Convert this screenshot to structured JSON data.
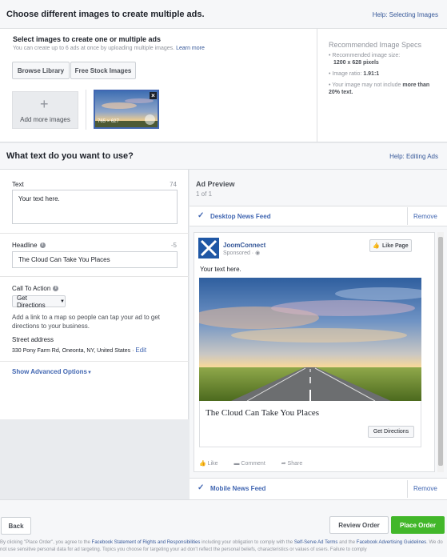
{
  "images_section": {
    "title": "Choose different images to create multiple ads.",
    "help_link": "Help: Selecting Images",
    "select_heading": "Select images to create one or multiple ads",
    "select_sub": "You can create up to 6 ads at once by uploading multiple images.",
    "learn_more": "Learn more",
    "browse_library": "Browse Library",
    "free_stock": "Free Stock Images",
    "add_more": "Add more images",
    "thumb_size": "765 × 627",
    "specs_title": "Recommended Image Specs",
    "specs": {
      "size_label": "Recommended image size:",
      "size_value": "1200 x 628 pixels",
      "ratio_label": "Image ratio:",
      "ratio_value": "1.91:1",
      "text_rule_a": "Your image may not include",
      "text_rule_b": "more than 20% text."
    }
  },
  "text_section": {
    "title": "What text do you want to use?",
    "help_link": "Help: Editing Ads",
    "text_label": "Text",
    "text_count": "74",
    "text_value": "Your text here.",
    "headline_label": "Headline",
    "headline_count": "-5",
    "headline_value": "The Cloud Can Take You Places",
    "cta_label": "Call To Action",
    "cta_value": "Get Directions",
    "cta_description": "Add a link to a map so people can tap your ad to get directions to your business.",
    "street_label": "Street address",
    "street_value": "330 Pony Farm Rd, Oneonta, NY, United States",
    "edit_link": "Edit",
    "advanced": "Show Advanced Options"
  },
  "preview": {
    "title": "Ad Preview",
    "pager": "1 of 1",
    "desktop_feed": "Desktop News Feed",
    "remove": "Remove",
    "page_name": "JoomConnect",
    "sponsored": "Sponsored",
    "like_page": "Like Page",
    "post_text": "Your text here.",
    "headline": "The Cloud Can Take You Places",
    "cta_button": "Get Directions",
    "actions": [
      "Like",
      "Comment",
      "Share"
    ],
    "mobile_feed": "Mobile News Feed",
    "remove_mobile": "Remove"
  },
  "footer": {
    "back": "Back",
    "review": "Review Order",
    "place": "Place Order",
    "legal_1": "By clicking \"Place Order\", you agree to the",
    "legal_link_1": "Facebook Statement of Rights and Responsibilities",
    "legal_2": "including your obligation to comply with the",
    "legal_link_2": "Self-Serve Ad Terms",
    "legal_3": "and the",
    "legal_link_3": "Facebook Advertising Guidelines",
    "legal_4": ". We do not use sensitive personal data for ad targeting. Topics you choose for targeting your ad don't reflect the personal beliefs, characteristics or values of users. Failure to comply"
  },
  "colors": {
    "accent": "#4267b2",
    "green": "#42b72a",
    "border": "#dddfe2"
  }
}
